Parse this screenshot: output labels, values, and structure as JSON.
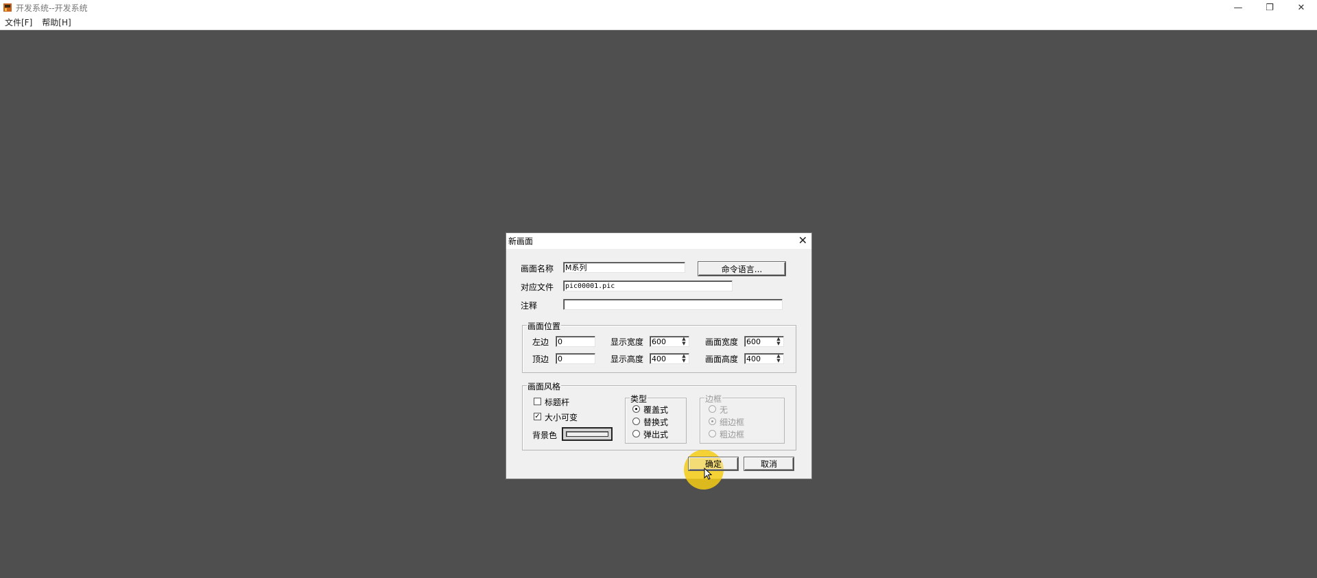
{
  "window": {
    "title": "开发系统--开发系统",
    "controls": {
      "minimize": "—",
      "restore": "❐",
      "close": "✕"
    }
  },
  "menu": [
    {
      "label": "文件[F]"
    },
    {
      "label": "帮助[H]"
    }
  ],
  "dialog": {
    "title": "新画面",
    "close": "✕",
    "fields": {
      "name_label": "画面名称",
      "name_value": "M系列",
      "file_label": "对应文件",
      "file_value": "pic00001.pic",
      "note_label": "注释",
      "note_value": ""
    },
    "command_button": "命令语言...",
    "position_group": {
      "legend": "画面位置",
      "left_label": "左边",
      "left_value": "0",
      "top_label": "顶边",
      "top_value": "0",
      "disp_width_label": "显示宽度",
      "disp_width_value": "600",
      "disp_height_label": "显示高度",
      "disp_height_value": "400",
      "pic_width_label": "画面宽度",
      "pic_width_value": "600",
      "pic_height_label": "画面高度",
      "pic_height_value": "400"
    },
    "style_group": {
      "legend": "画面风格",
      "titlebar_label": "标题杆",
      "titlebar_checked": false,
      "resizable_label": "大小可变",
      "resizable_checked": true,
      "bgcolor_label": "背景色",
      "type_group": {
        "legend": "类型",
        "options": [
          "覆盖式",
          "替换式",
          "弹出式"
        ],
        "selected": 0
      },
      "border_group": {
        "legend": "边框",
        "options": [
          "无",
          "细边框",
          "粗边框"
        ],
        "selected": 1,
        "disabled": true
      }
    },
    "ok_button": "确定",
    "cancel_button": "取消"
  },
  "colors": {
    "desktop": "#4f4f4f",
    "dialog_bg": "#f0f0f0",
    "cursor_highlight": "#f5cd14"
  },
  "icons": {
    "spin": "spin-up-down-icon",
    "cursor": "mouse-pointer-icon"
  }
}
